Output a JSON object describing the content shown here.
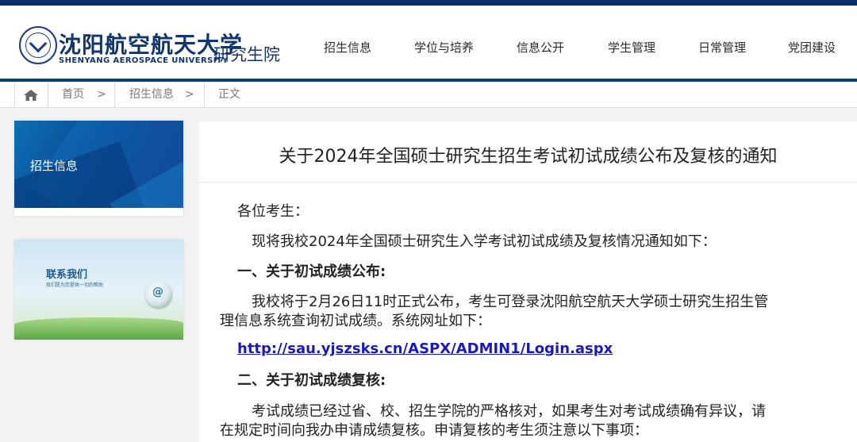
{
  "header": {
    "logo_cn": "沈阳航空航天大学",
    "logo_en": "SHENYANG AEROSPACE UNIVERSITY",
    "logo_grad": "研究生院",
    "nav": [
      "招生信息",
      "学位与培养",
      "信息公开",
      "学生管理",
      "日常管理",
      "党团建设"
    ]
  },
  "breadcrumb": {
    "home_icon": "home-icon",
    "items": [
      "首页",
      ">",
      "招生信息",
      ">",
      "正文"
    ]
  },
  "sidebar": {
    "section_title": "招生信息",
    "contact_title": "联系我们",
    "contact_sub": "我们愿为您提供一切的帮助",
    "contact_icon": "@"
  },
  "article": {
    "title": "关于2024年全国硕士研究生招生考试初试成绩公布及复核的通知",
    "greeting": "各位考生：",
    "intro": "现将我校2024年全国硕士研究生入学考试初试成绩及复核情况通知如下：",
    "section1_heading": "一、关于初试成绩公布:",
    "section1_line1": "我校将于2月26日11时正式公布，考生可登录沈阳航空航天大学硕士研究生招生管",
    "section1_line2": "理信息系统查询初试成绩。系统网址如下：",
    "link": "http://sau.yjszsks.cn/ASPX/ADMIN1/Login.aspx",
    "section2_heading": "二、关于初试成绩复核:",
    "section2_line1": "考试成绩已经过省、校、招生学院的严格核对，如果考生对考试成绩确有异议，请",
    "section2_line2": "在规定时间向我办申请成绩复核。申请复核的考生须注意以下事项："
  },
  "colors": {
    "brand_navy": "#0c2f69",
    "link_blue": "#1a1ab8"
  }
}
